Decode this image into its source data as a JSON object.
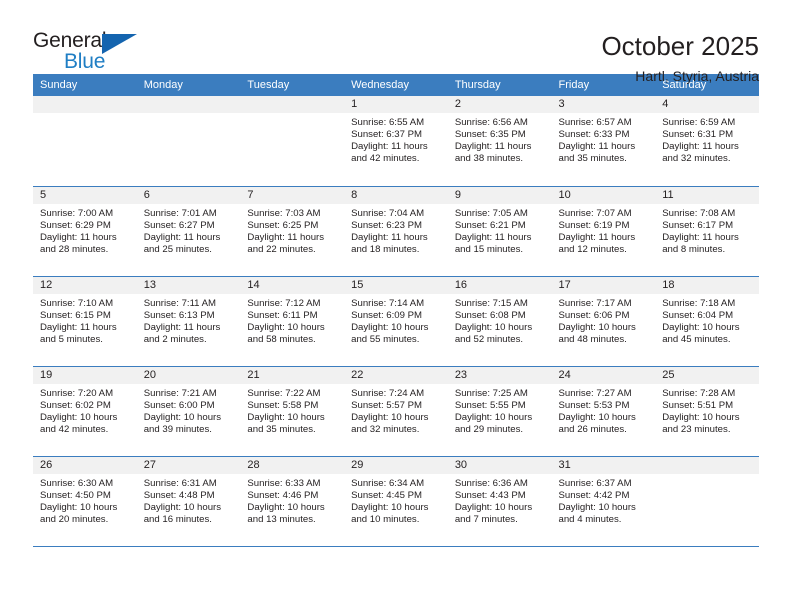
{
  "brand": {
    "name_dark": "General",
    "name_blue": "Blue",
    "accent_color": "#1f7ec4",
    "triangle_color": "#1464af"
  },
  "header": {
    "title": "October 2025",
    "subtitle": "Hartl, Styria, Austria"
  },
  "calendar": {
    "header_bg": "#3b7dbf",
    "daynum_bg": "#f1f1f1",
    "weekdays": [
      "Sunday",
      "Monday",
      "Tuesday",
      "Wednesday",
      "Thursday",
      "Friday",
      "Saturday"
    ],
    "labels": {
      "sunrise": "Sunrise:",
      "sunset": "Sunset:",
      "daylight": "Daylight:"
    },
    "weeks": [
      [
        {
          "day": "",
          "empty": true
        },
        {
          "day": "",
          "empty": true
        },
        {
          "day": "",
          "empty": true
        },
        {
          "day": "1",
          "sunrise": "Sunrise: 6:55 AM",
          "sunset": "Sunset: 6:37 PM",
          "daylight": "Daylight: 11 hours and 42 minutes."
        },
        {
          "day": "2",
          "sunrise": "Sunrise: 6:56 AM",
          "sunset": "Sunset: 6:35 PM",
          "daylight": "Daylight: 11 hours and 38 minutes."
        },
        {
          "day": "3",
          "sunrise": "Sunrise: 6:57 AM",
          "sunset": "Sunset: 6:33 PM",
          "daylight": "Daylight: 11 hours and 35 minutes."
        },
        {
          "day": "4",
          "sunrise": "Sunrise: 6:59 AM",
          "sunset": "Sunset: 6:31 PM",
          "daylight": "Daylight: 11 hours and 32 minutes."
        }
      ],
      [
        {
          "day": "5",
          "sunrise": "Sunrise: 7:00 AM",
          "sunset": "Sunset: 6:29 PM",
          "daylight": "Daylight: 11 hours and 28 minutes."
        },
        {
          "day": "6",
          "sunrise": "Sunrise: 7:01 AM",
          "sunset": "Sunset: 6:27 PM",
          "daylight": "Daylight: 11 hours and 25 minutes."
        },
        {
          "day": "7",
          "sunrise": "Sunrise: 7:03 AM",
          "sunset": "Sunset: 6:25 PM",
          "daylight": "Daylight: 11 hours and 22 minutes."
        },
        {
          "day": "8",
          "sunrise": "Sunrise: 7:04 AM",
          "sunset": "Sunset: 6:23 PM",
          "daylight": "Daylight: 11 hours and 18 minutes."
        },
        {
          "day": "9",
          "sunrise": "Sunrise: 7:05 AM",
          "sunset": "Sunset: 6:21 PM",
          "daylight": "Daylight: 11 hours and 15 minutes."
        },
        {
          "day": "10",
          "sunrise": "Sunrise: 7:07 AM",
          "sunset": "Sunset: 6:19 PM",
          "daylight": "Daylight: 11 hours and 12 minutes."
        },
        {
          "day": "11",
          "sunrise": "Sunrise: 7:08 AM",
          "sunset": "Sunset: 6:17 PM",
          "daylight": "Daylight: 11 hours and 8 minutes."
        }
      ],
      [
        {
          "day": "12",
          "sunrise": "Sunrise: 7:10 AM",
          "sunset": "Sunset: 6:15 PM",
          "daylight": "Daylight: 11 hours and 5 minutes."
        },
        {
          "day": "13",
          "sunrise": "Sunrise: 7:11 AM",
          "sunset": "Sunset: 6:13 PM",
          "daylight": "Daylight: 11 hours and 2 minutes."
        },
        {
          "day": "14",
          "sunrise": "Sunrise: 7:12 AM",
          "sunset": "Sunset: 6:11 PM",
          "daylight": "Daylight: 10 hours and 58 minutes."
        },
        {
          "day": "15",
          "sunrise": "Sunrise: 7:14 AM",
          "sunset": "Sunset: 6:09 PM",
          "daylight": "Daylight: 10 hours and 55 minutes."
        },
        {
          "day": "16",
          "sunrise": "Sunrise: 7:15 AM",
          "sunset": "Sunset: 6:08 PM",
          "daylight": "Daylight: 10 hours and 52 minutes."
        },
        {
          "day": "17",
          "sunrise": "Sunrise: 7:17 AM",
          "sunset": "Sunset: 6:06 PM",
          "daylight": "Daylight: 10 hours and 48 minutes."
        },
        {
          "day": "18",
          "sunrise": "Sunrise: 7:18 AM",
          "sunset": "Sunset: 6:04 PM",
          "daylight": "Daylight: 10 hours and 45 minutes."
        }
      ],
      [
        {
          "day": "19",
          "sunrise": "Sunrise: 7:20 AM",
          "sunset": "Sunset: 6:02 PM",
          "daylight": "Daylight: 10 hours and 42 minutes."
        },
        {
          "day": "20",
          "sunrise": "Sunrise: 7:21 AM",
          "sunset": "Sunset: 6:00 PM",
          "daylight": "Daylight: 10 hours and 39 minutes."
        },
        {
          "day": "21",
          "sunrise": "Sunrise: 7:22 AM",
          "sunset": "Sunset: 5:58 PM",
          "daylight": "Daylight: 10 hours and 35 minutes."
        },
        {
          "day": "22",
          "sunrise": "Sunrise: 7:24 AM",
          "sunset": "Sunset: 5:57 PM",
          "daylight": "Daylight: 10 hours and 32 minutes."
        },
        {
          "day": "23",
          "sunrise": "Sunrise: 7:25 AM",
          "sunset": "Sunset: 5:55 PM",
          "daylight": "Daylight: 10 hours and 29 minutes."
        },
        {
          "day": "24",
          "sunrise": "Sunrise: 7:27 AM",
          "sunset": "Sunset: 5:53 PM",
          "daylight": "Daylight: 10 hours and 26 minutes."
        },
        {
          "day": "25",
          "sunrise": "Sunrise: 7:28 AM",
          "sunset": "Sunset: 5:51 PM",
          "daylight": "Daylight: 10 hours and 23 minutes."
        }
      ],
      [
        {
          "day": "26",
          "sunrise": "Sunrise: 6:30 AM",
          "sunset": "Sunset: 4:50 PM",
          "daylight": "Daylight: 10 hours and 20 minutes."
        },
        {
          "day": "27",
          "sunrise": "Sunrise: 6:31 AM",
          "sunset": "Sunset: 4:48 PM",
          "daylight": "Daylight: 10 hours and 16 minutes."
        },
        {
          "day": "28",
          "sunrise": "Sunrise: 6:33 AM",
          "sunset": "Sunset: 4:46 PM",
          "daylight": "Daylight: 10 hours and 13 minutes."
        },
        {
          "day": "29",
          "sunrise": "Sunrise: 6:34 AM",
          "sunset": "Sunset: 4:45 PM",
          "daylight": "Daylight: 10 hours and 10 minutes."
        },
        {
          "day": "30",
          "sunrise": "Sunrise: 6:36 AM",
          "sunset": "Sunset: 4:43 PM",
          "daylight": "Daylight: 10 hours and 7 minutes."
        },
        {
          "day": "31",
          "sunrise": "Sunrise: 6:37 AM",
          "sunset": "Sunset: 4:42 PM",
          "daylight": "Daylight: 10 hours and 4 minutes."
        },
        {
          "day": "",
          "empty": true
        }
      ]
    ]
  }
}
